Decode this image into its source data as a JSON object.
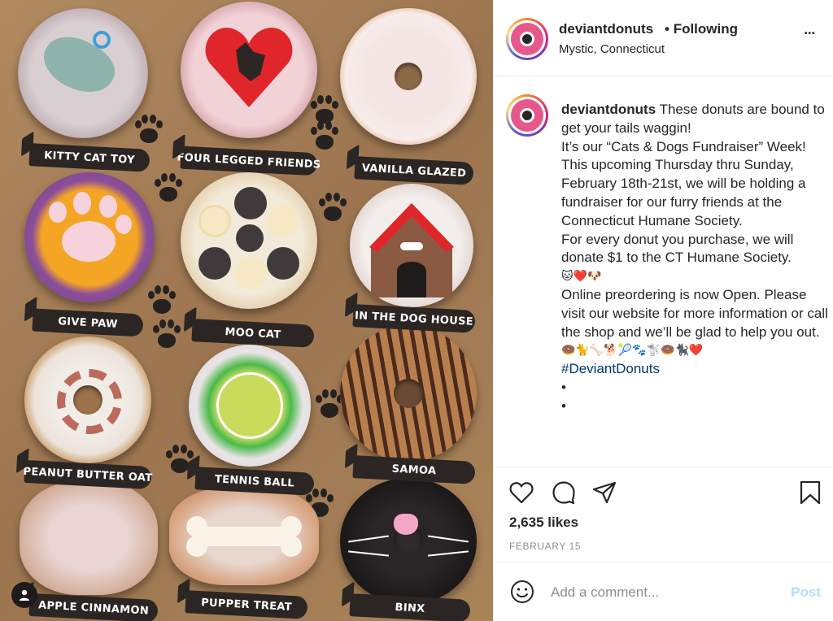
{
  "post": {
    "username": "deviantdonuts",
    "separator": "•",
    "following_label": "Following",
    "location": "Mystic, Connecticut",
    "more_label": "•••"
  },
  "photo": {
    "donuts": [
      {
        "label": "KITTY CAT TOY"
      },
      {
        "label": "FOUR LEGGED FRIENDS"
      },
      {
        "label": "VANILLA GLAZED"
      },
      {
        "label": "GIVE PAW"
      },
      {
        "label": "MOO CAT"
      },
      {
        "label": "IN THE DOG HOUSE"
      },
      {
        "label": "PEANUT BUTTER OAT"
      },
      {
        "label": "TENNIS BALL"
      },
      {
        "label": "SAMOA"
      },
      {
        "label": "APPLE CINNAMON"
      },
      {
        "label": "PUPPER TREAT"
      },
      {
        "label": "BINX"
      }
    ]
  },
  "caption": {
    "username": "deviantdonuts",
    "line1": " These donuts are bound to get your tails waggin!",
    "line2": "It’s our “Cats & Dogs Fundraiser” Week! This upcoming Thursday thru Sunday, February 18th-21st, we will be holding a fundraiser for our furry friends at the Connecticut Humane Society.",
    "line3": "For every donut you purchase, we will donate $1 to the CT Humane Society.",
    "emoji1": "🐱❤️🐶",
    "line4": "Online preordering is now Open. Please visit our website for more information or call the shop and we’ll be glad to help you out.",
    "emoji2": "🍩🐈🦴🐕🎾🐾🐩🍩🐈‍⬛❤️",
    "hashtag": "#DeviantDonuts",
    "dot1": "•",
    "dot2": "•",
    "dot3": "•"
  },
  "stats": {
    "likes": "2,635 likes",
    "date": "FEBRUARY 15"
  },
  "comment": {
    "placeholder": "Add a comment...",
    "post_label": "Post"
  },
  "colors": {
    "link": "#00376b",
    "post_disabled": "#b2dffc",
    "muted": "#8e8e8e"
  }
}
